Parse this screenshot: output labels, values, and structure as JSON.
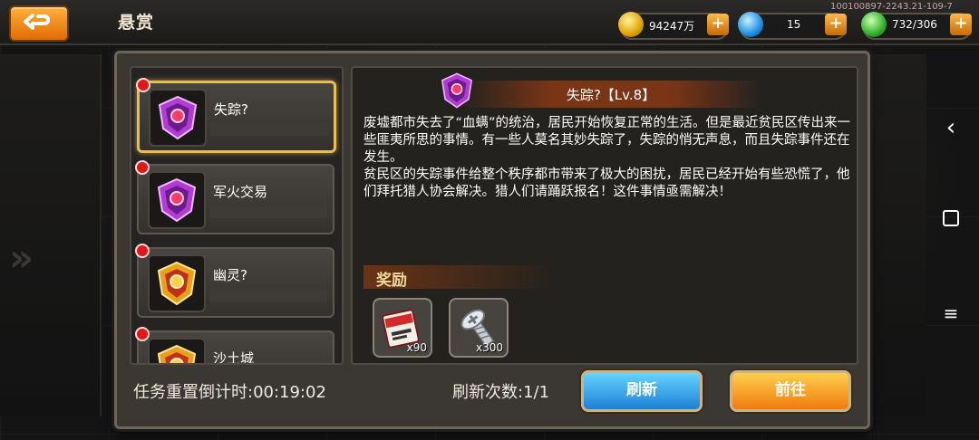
{
  "header": {
    "title": "悬赏",
    "id_text": "100100897-2243.21-109-7",
    "resources": [
      {
        "icon": "gold-coin-icon",
        "value": "94247万"
      },
      {
        "icon": "blue-crystal-icon",
        "value": "15"
      },
      {
        "icon": "energy-gem-icon",
        "value": "732/306"
      }
    ]
  },
  "quests": [
    {
      "label": "失踪?",
      "badge": "purple-shield-badge-icon",
      "selected": true
    },
    {
      "label": "军火交易",
      "badge": "purple-shield-badge-icon",
      "selected": false
    },
    {
      "label": "幽灵?",
      "badge": "gold-shield-badge-icon",
      "selected": false
    },
    {
      "label": "沙土城",
      "badge": "gold-shield-badge-icon",
      "selected": false
    }
  ],
  "detail": {
    "title": "失踪?【Lv.8】",
    "description": "废墟都市失去了“血螨”的统治，居民开始恢复正常的生活。但是最近贫民区传出来一些匪夷所思的事情。有一些人莫名其妙失踪了，失踪的悄无声息，而且失踪事件还在发生。\n贫民区的失踪事件给整个秩序都市带来了极大的困扰，居民已经开始有些恐慌了，他们拜托猎人协会解决。猎人们请踊跃报名！这件事情亟需解决！",
    "reward_label": "奖励",
    "rewards": [
      {
        "icon": "ticket-scroll-icon",
        "count": "x90"
      },
      {
        "icon": "screw-bolt-icon",
        "count": "x300"
      }
    ]
  },
  "footer": {
    "countdown": "任务重置倒计时:00:19:02",
    "refresh_count": "刷新次数:1/1",
    "refresh_button": "刷新",
    "go_button": "前往"
  },
  "colors": {
    "accent_orange": "#ef7b0c",
    "accent_blue": "#1d7fd6",
    "selected_border": "#e7bd54"
  }
}
